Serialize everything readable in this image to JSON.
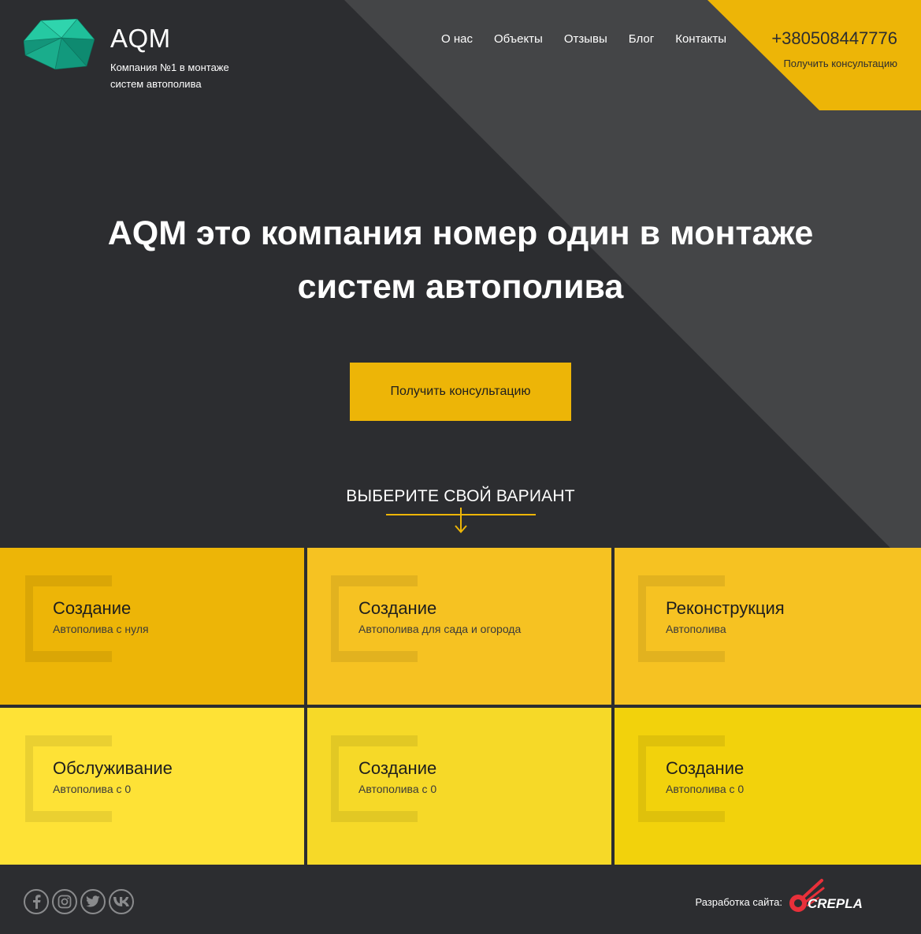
{
  "header": {
    "brand": "AQM",
    "tagline": "Компания №1 в монтаже систем автополива",
    "nav": [
      "О нас",
      "Объекты",
      "Отзывы",
      "Блог",
      "Контакты"
    ],
    "phone": "+380508447776",
    "consult_link": "Получить консультацию"
  },
  "hero": {
    "headline": "AQM это компания номер один в монтаже систем автополива",
    "cta_label": "Получить консультацию",
    "choose_label": "ВЫБЕРИТЕ СВОЙ ВАРИАНТ"
  },
  "cards": [
    {
      "title": "Создание",
      "subtitle": "Автополива с нуля",
      "color": "#edb507"
    },
    {
      "title": "Создание",
      "subtitle": "Автополива для сада и огорода",
      "color": "#f6c222"
    },
    {
      "title": "Реконструкция",
      "subtitle": "Автополива",
      "color": "#f6c222"
    },
    {
      "title": "Обслуживание",
      "subtitle": "Автополива с 0",
      "color": "#fee236"
    },
    {
      "title": "Создание",
      "subtitle": "Автополива с 0",
      "color": "#f6d928"
    },
    {
      "title": "Создание",
      "subtitle": "Автополива с 0",
      "color": "#f2d20c"
    }
  ],
  "footer": {
    "socials": [
      "facebook-icon",
      "instagram-icon",
      "twitter-icon",
      "vk-icon"
    ],
    "dev_label": "Разработка сайта:",
    "dev_brand": "CREPLA"
  },
  "colors": {
    "accent": "#edb507",
    "background": "#2c2d30",
    "stripe": "#444547",
    "logo_teal": "#1fbf9a"
  }
}
